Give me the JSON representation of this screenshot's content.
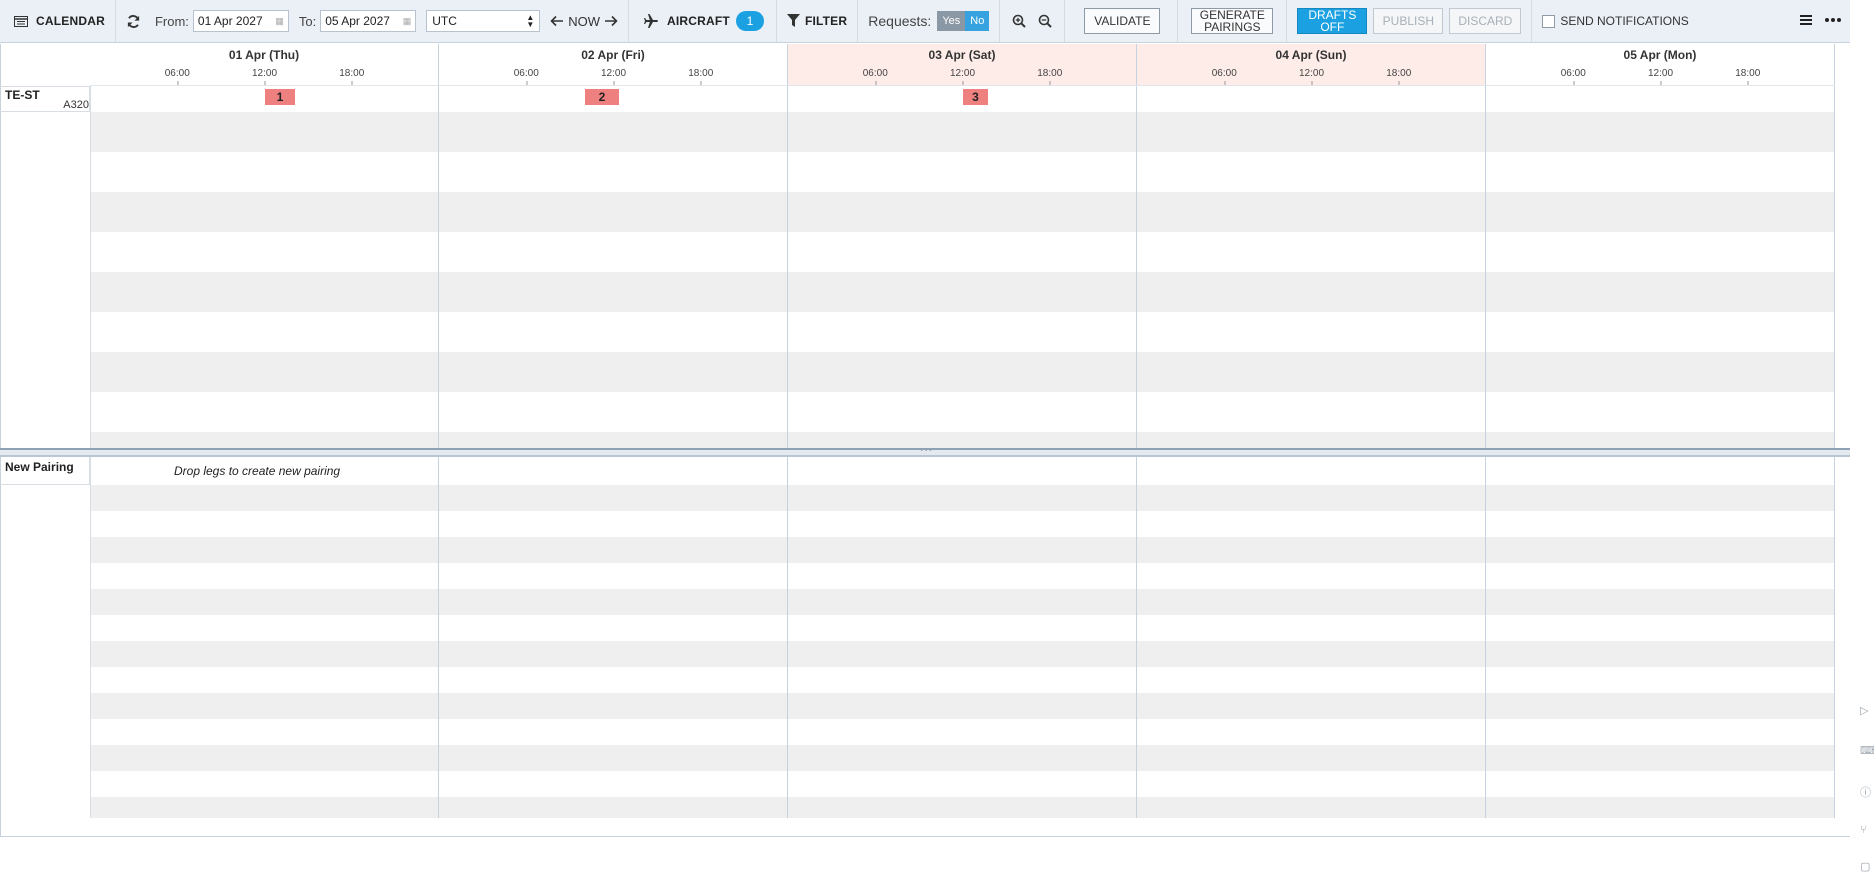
{
  "toolbar": {
    "calendar_label": "CALENDAR",
    "from_label": "From:",
    "from_value": "01 Apr 2027",
    "to_label": "To:",
    "to_value": "05 Apr 2027",
    "timezone": "UTC",
    "now_label": "NOW",
    "aircraft_label": "AIRCRAFT",
    "aircraft_count": "1",
    "filter_label": "FILTER",
    "requests_label": "Requests:",
    "requests_yes": "Yes",
    "requests_no": "No",
    "validate_label": "VALIDATE",
    "generate_line1": "GENERATE",
    "generate_line2": "PAIRINGS",
    "drafts_line1": "DRAFTS",
    "drafts_line2": "OFF",
    "publish_label": "PUBLISH",
    "discard_label": "DISCARD",
    "send_notifications_label": "SEND NOTIFICATIONS"
  },
  "days": [
    {
      "title": "01 Apr (Thu)",
      "weekend": false
    },
    {
      "title": "02 Apr (Fri)",
      "weekend": false
    },
    {
      "title": "03 Apr (Sat)",
      "weekend": true
    },
    {
      "title": "04 Apr (Sun)",
      "weekend": true
    },
    {
      "title": "05 Apr (Mon)",
      "weekend": false
    }
  ],
  "ticks": [
    "06:00",
    "12:00",
    "18:00"
  ],
  "aircraft_row": {
    "registration": "TE-ST",
    "type": "A320"
  },
  "flights": [
    {
      "label": "1"
    },
    {
      "label": "2"
    },
    {
      "label": "3"
    }
  ],
  "pairing": {
    "title": "New Pairing",
    "drop_hint": "Drop legs to create new pairing"
  },
  "colors": {
    "accent": "#1ba1e2",
    "weekend_header": "#fdece8",
    "flight_chip": "#ef8080",
    "stripe": "#efefef"
  }
}
